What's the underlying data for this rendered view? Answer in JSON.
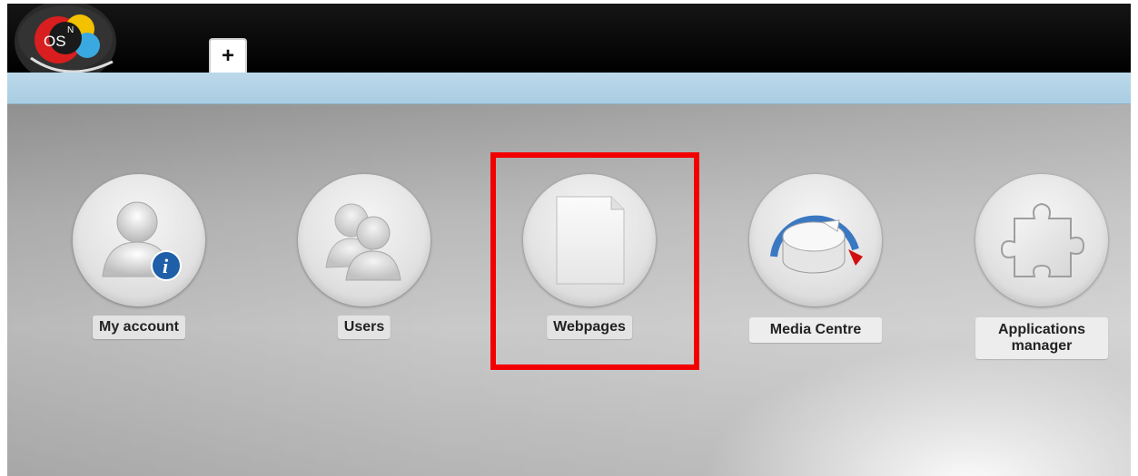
{
  "logo": {
    "text": "OS",
    "superscript": "N"
  },
  "topbar": {
    "add_tab_label": "+"
  },
  "apps": [
    {
      "label": "My account",
      "icon": "user-info-icon"
    },
    {
      "label": "Users",
      "icon": "users-icon"
    },
    {
      "label": "Webpages",
      "icon": "webpage-icon"
    },
    {
      "label": "Media Centre",
      "icon": "media-knob-icon"
    },
    {
      "label": "Applications manager",
      "icon": "puzzle-icon"
    }
  ],
  "colors": {
    "topbar": "#000000",
    "bluebar": "#aecfe4",
    "highlight": "#f20000"
  }
}
